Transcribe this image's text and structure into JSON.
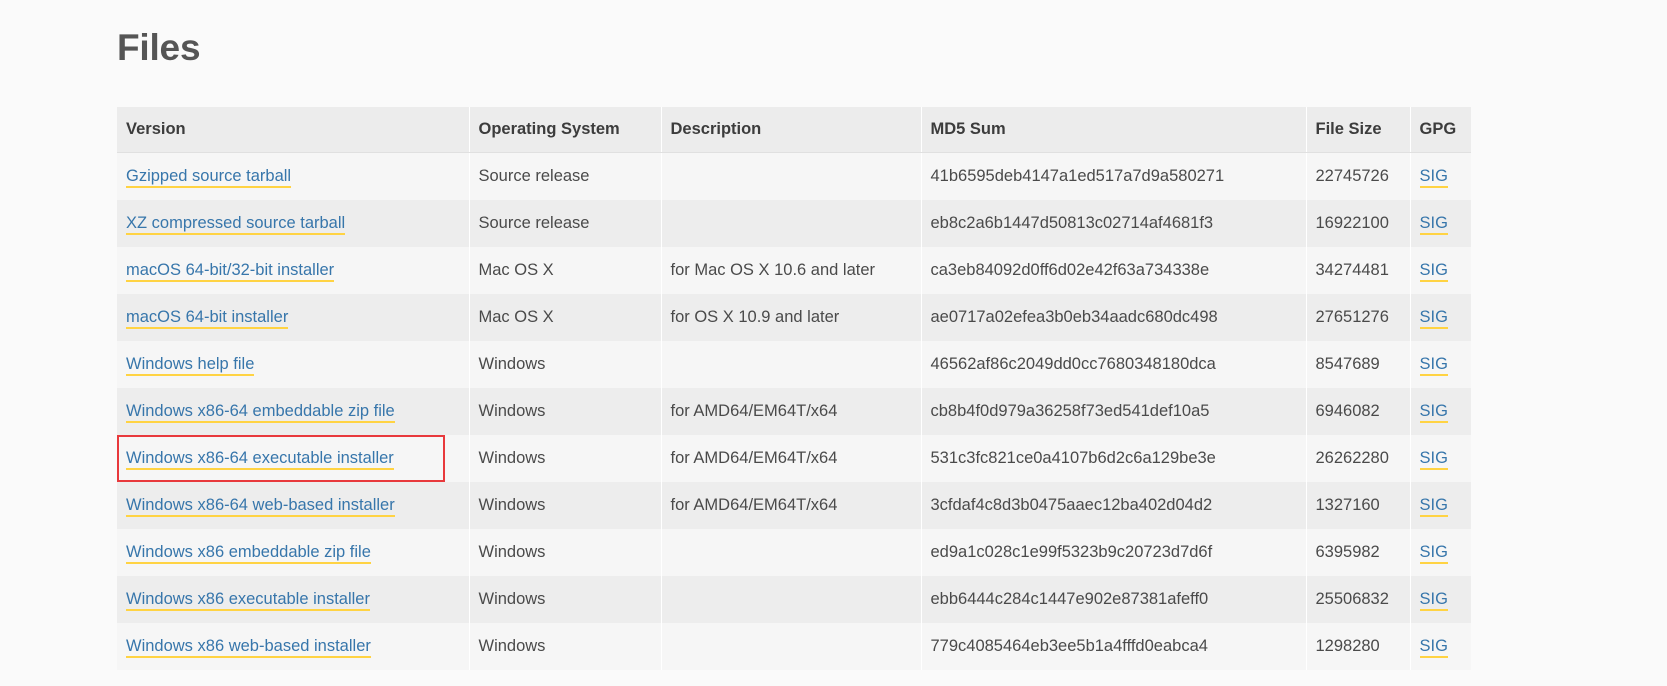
{
  "page": {
    "title": "Files",
    "background_color": "#fafafa",
    "heading_color": "#555555",
    "link_color": "#3776ab",
    "link_underline_color": "#ffd343",
    "highlight_color": "#e8393c"
  },
  "table": {
    "columns": [
      {
        "key": "version",
        "label": "Version"
      },
      {
        "key": "operating_system",
        "label": "Operating System"
      },
      {
        "key": "description",
        "label": "Description"
      },
      {
        "key": "md5_sum",
        "label": "MD5 Sum"
      },
      {
        "key": "file_size",
        "label": "File Size"
      },
      {
        "key": "gpg",
        "label": "GPG"
      }
    ],
    "gpg_link_label": "SIG",
    "rows": [
      {
        "version": "Gzipped source tarball",
        "operating_system": "Source release",
        "description": "",
        "md5_sum": "41b6595deb4147a1ed517a7d9a580271",
        "file_size": "22745726",
        "gpg": "SIG"
      },
      {
        "version": "XZ compressed source tarball",
        "operating_system": "Source release",
        "description": "",
        "md5_sum": "eb8c2a6b1447d50813c02714af4681f3",
        "file_size": "16922100",
        "gpg": "SIG"
      },
      {
        "version": "macOS 64-bit/32-bit installer",
        "operating_system": "Mac OS X",
        "description": "for Mac OS X 10.6 and later",
        "md5_sum": "ca3eb84092d0ff6d02e42f63a734338e",
        "file_size": "34274481",
        "gpg": "SIG"
      },
      {
        "version": "macOS 64-bit installer",
        "operating_system": "Mac OS X",
        "description": "for OS X 10.9 and later",
        "md5_sum": "ae0717a02efea3b0eb34aadc680dc498",
        "file_size": "27651276",
        "gpg": "SIG"
      },
      {
        "version": "Windows help file",
        "operating_system": "Windows",
        "description": "",
        "md5_sum": "46562af86c2049dd0cc7680348180dca",
        "file_size": "8547689",
        "gpg": "SIG"
      },
      {
        "version": "Windows x86-64 embeddable zip file",
        "operating_system": "Windows",
        "description": "for AMD64/EM64T/x64",
        "md5_sum": "cb8b4f0d979a36258f73ed541def10a5",
        "file_size": "6946082",
        "gpg": "SIG"
      },
      {
        "version": "Windows x86-64 executable installer",
        "operating_system": "Windows",
        "description": "for AMD64/EM64T/x64",
        "md5_sum": "531c3fc821ce0a4107b6d2c6a129be3e",
        "file_size": "26262280",
        "gpg": "SIG",
        "highlighted": true
      },
      {
        "version": "Windows x86-64 web-based installer",
        "operating_system": "Windows",
        "description": "for AMD64/EM64T/x64",
        "md5_sum": "3cfdaf4c8d3b0475aaec12ba402d04d2",
        "file_size": "1327160",
        "gpg": "SIG"
      },
      {
        "version": "Windows x86 embeddable zip file",
        "operating_system": "Windows",
        "description": "",
        "md5_sum": "ed9a1c028c1e99f5323b9c20723d7d6f",
        "file_size": "6395982",
        "gpg": "SIG"
      },
      {
        "version": "Windows x86 executable installer",
        "operating_system": "Windows",
        "description": "",
        "md5_sum": "ebb6444c284c1447e902e87381afeff0",
        "file_size": "25506832",
        "gpg": "SIG"
      },
      {
        "version": "Windows x86 web-based installer",
        "operating_system": "Windows",
        "description": "",
        "md5_sum": "779c4085464eb3ee5b1a4fffd0eabca4",
        "file_size": "1298280",
        "gpg": "SIG"
      }
    ]
  }
}
